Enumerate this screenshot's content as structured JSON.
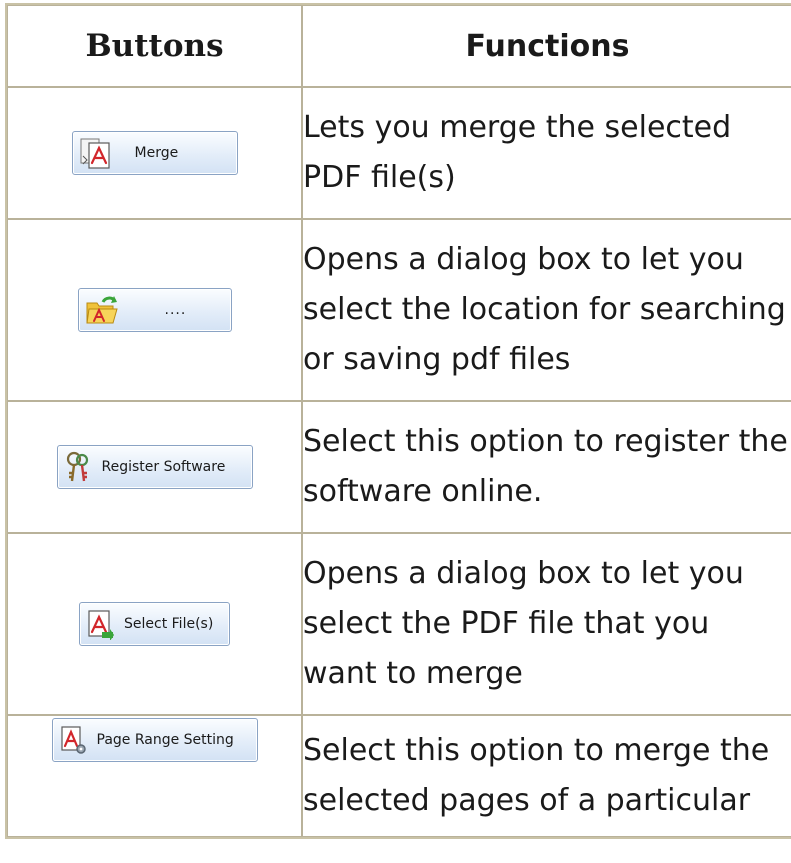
{
  "table": {
    "headers": {
      "buttons": "Buttons",
      "functions": "Functions"
    },
    "rows": [
      {
        "button_label": "Merge",
        "button_icon": "pdf-merge-icon",
        "description": "Lets you merge the selected PDF file(s)"
      },
      {
        "button_label": "....",
        "button_icon": "folder-pdf-icon",
        "description": "Opens a dialog box to let you select the location for searching or saving pdf files"
      },
      {
        "button_label": "Register Software",
        "button_icon": "keys-icon",
        "description": "Select this option to register the software online."
      },
      {
        "button_label": "Select File(s)",
        "button_icon": "pdf-add-icon",
        "description": "Opens a dialog box to let you select the PDF file that you want to merge"
      },
      {
        "button_label": "Page Range Setting",
        "button_icon": "pdf-gear-icon",
        "description": "Select this option to merge the selected pages of a particular"
      }
    ]
  },
  "colors": {
    "table_border": "#c9c2a6",
    "button_border": "#8aa3c4",
    "pdf_red": "#d2262b",
    "text": "#1a1a1a"
  }
}
